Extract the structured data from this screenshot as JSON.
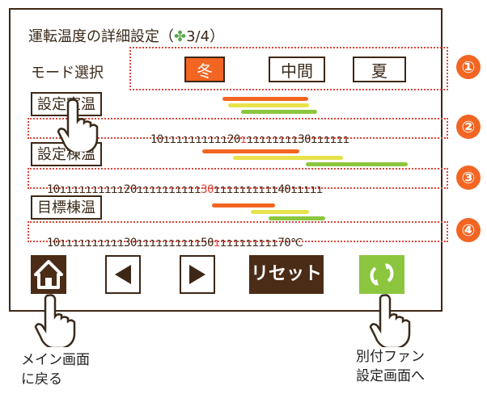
{
  "header": {
    "title": "運転温度の詳細設定（",
    "fan_icon": "fan-icon",
    "page": "3/4）"
  },
  "mode": {
    "label": "モード選択",
    "options": [
      "冬",
      "中間",
      "夏"
    ],
    "active": "冬",
    "active_color": "#f26522"
  },
  "sections": [
    {
      "label": "設定室温",
      "badge": "①"
    },
    {
      "label": "設定棟温",
      "badge": "③"
    },
    {
      "label": "目標棟温",
      "badge": "④"
    }
  ],
  "scales": [
    {
      "pre": "10",
      "ticks1": "ıııııııııı",
      "mid": "20",
      "red": "ı",
      "ticks2": "ıııııııı",
      "end": "30",
      "ticks3": "ıııııı",
      "badge": "②"
    },
    {
      "pre": "10",
      "ticks1": "ıııııııııı",
      "mid": "20",
      "red": "30",
      "ticks2": "ıııııııııı",
      "end": "40",
      "ticks3": "ııııı",
      "badge": "③"
    },
    {
      "pre": "10",
      "ticks1": "ıııııııııı",
      "mid": "30",
      "red": "ı",
      "ticks2": "ıııııııııı",
      "end": "50",
      "ticks3": "ııııııııı70℃",
      "badge": "④"
    }
  ],
  "toolbar": {
    "home_icon": "home-icon",
    "prev_icon": "prev-arrow-icon",
    "next_icon": "next-arrow-icon",
    "reset_label": "リセット",
    "fan_icon": "fan-settings-icon"
  },
  "captions": {
    "left": [
      "メイン画面",
      "に戻る"
    ],
    "right": [
      "別付ファン",
      "設定画面へ"
    ]
  },
  "colors": {
    "orange": "#f26522",
    "yellow": "#e8e24a",
    "green": "#8cc63f",
    "brown": "#4a2c17"
  }
}
